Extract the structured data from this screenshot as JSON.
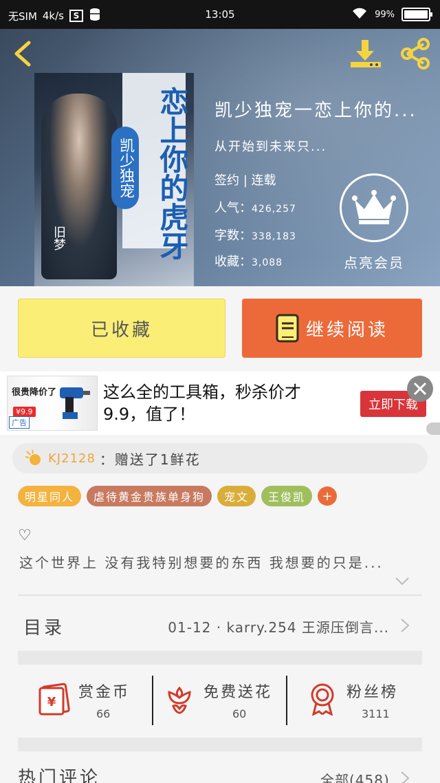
{
  "status_bar": {
    "carrier": "无SIM",
    "speed": "4k/s",
    "time": "13:05",
    "battery": "99%"
  },
  "book": {
    "cover": {
      "title": "恋上你的虎牙",
      "subtitle": "凯少独宠",
      "author": "旧梦"
    },
    "title": "凯少独宠一恋上你的...",
    "short_desc": "从开始到未来只...",
    "status": "签约 | 连载",
    "popularity_label": "人气：",
    "popularity": "426,257",
    "wordcount_label": "字数：",
    "wordcount": "338,183",
    "favorites_label": "收藏：",
    "favorites": "3,088",
    "vip_label": "点亮会员"
  },
  "buttons": {
    "collected": "已收藏",
    "continue_reading": "继续阅读"
  },
  "ad": {
    "image_headline": "很贵降价了",
    "image_price": "¥9.9",
    "tag": "广告",
    "text": "这么全的工具箱，秒杀价才9.9，值了！",
    "cta": "立即下载"
  },
  "ticker": {
    "user": "KJ2128",
    "message": "：赠送了1鲜花"
  },
  "tags": [
    {
      "label": "明星同人",
      "color": "#f4b23f"
    },
    {
      "label": "虐待黄金贵族单身狗",
      "color": "#c77a5f"
    },
    {
      "label": "宠文",
      "color": "#d9ad3a"
    },
    {
      "label": "王俊凯",
      "color": "#9fbf5e"
    }
  ],
  "tag_add": "+",
  "intro": {
    "heart": "♡",
    "text": "这个世界上 没有我特别想要的东西 我想要的只是..."
  },
  "toc": {
    "label": "目录",
    "latest": "01-12 · karry.254 王源压倒言..."
  },
  "actions": [
    {
      "label": "赏金币",
      "count": "66",
      "icon": "red-envelope-icon"
    },
    {
      "label": "免费送花",
      "count": "60",
      "icon": "flower-icon"
    },
    {
      "label": "粉丝榜",
      "count": "3111",
      "icon": "medal-icon"
    }
  ],
  "hot_comments": {
    "label": "热门评论",
    "all": "全部(458)"
  },
  "colors": {
    "accent_orange": "#ec6a3a",
    "collected_yellow": "#fbee76",
    "icon_red": "#d23a2a",
    "header_icon_yellow": "#f5d442"
  }
}
